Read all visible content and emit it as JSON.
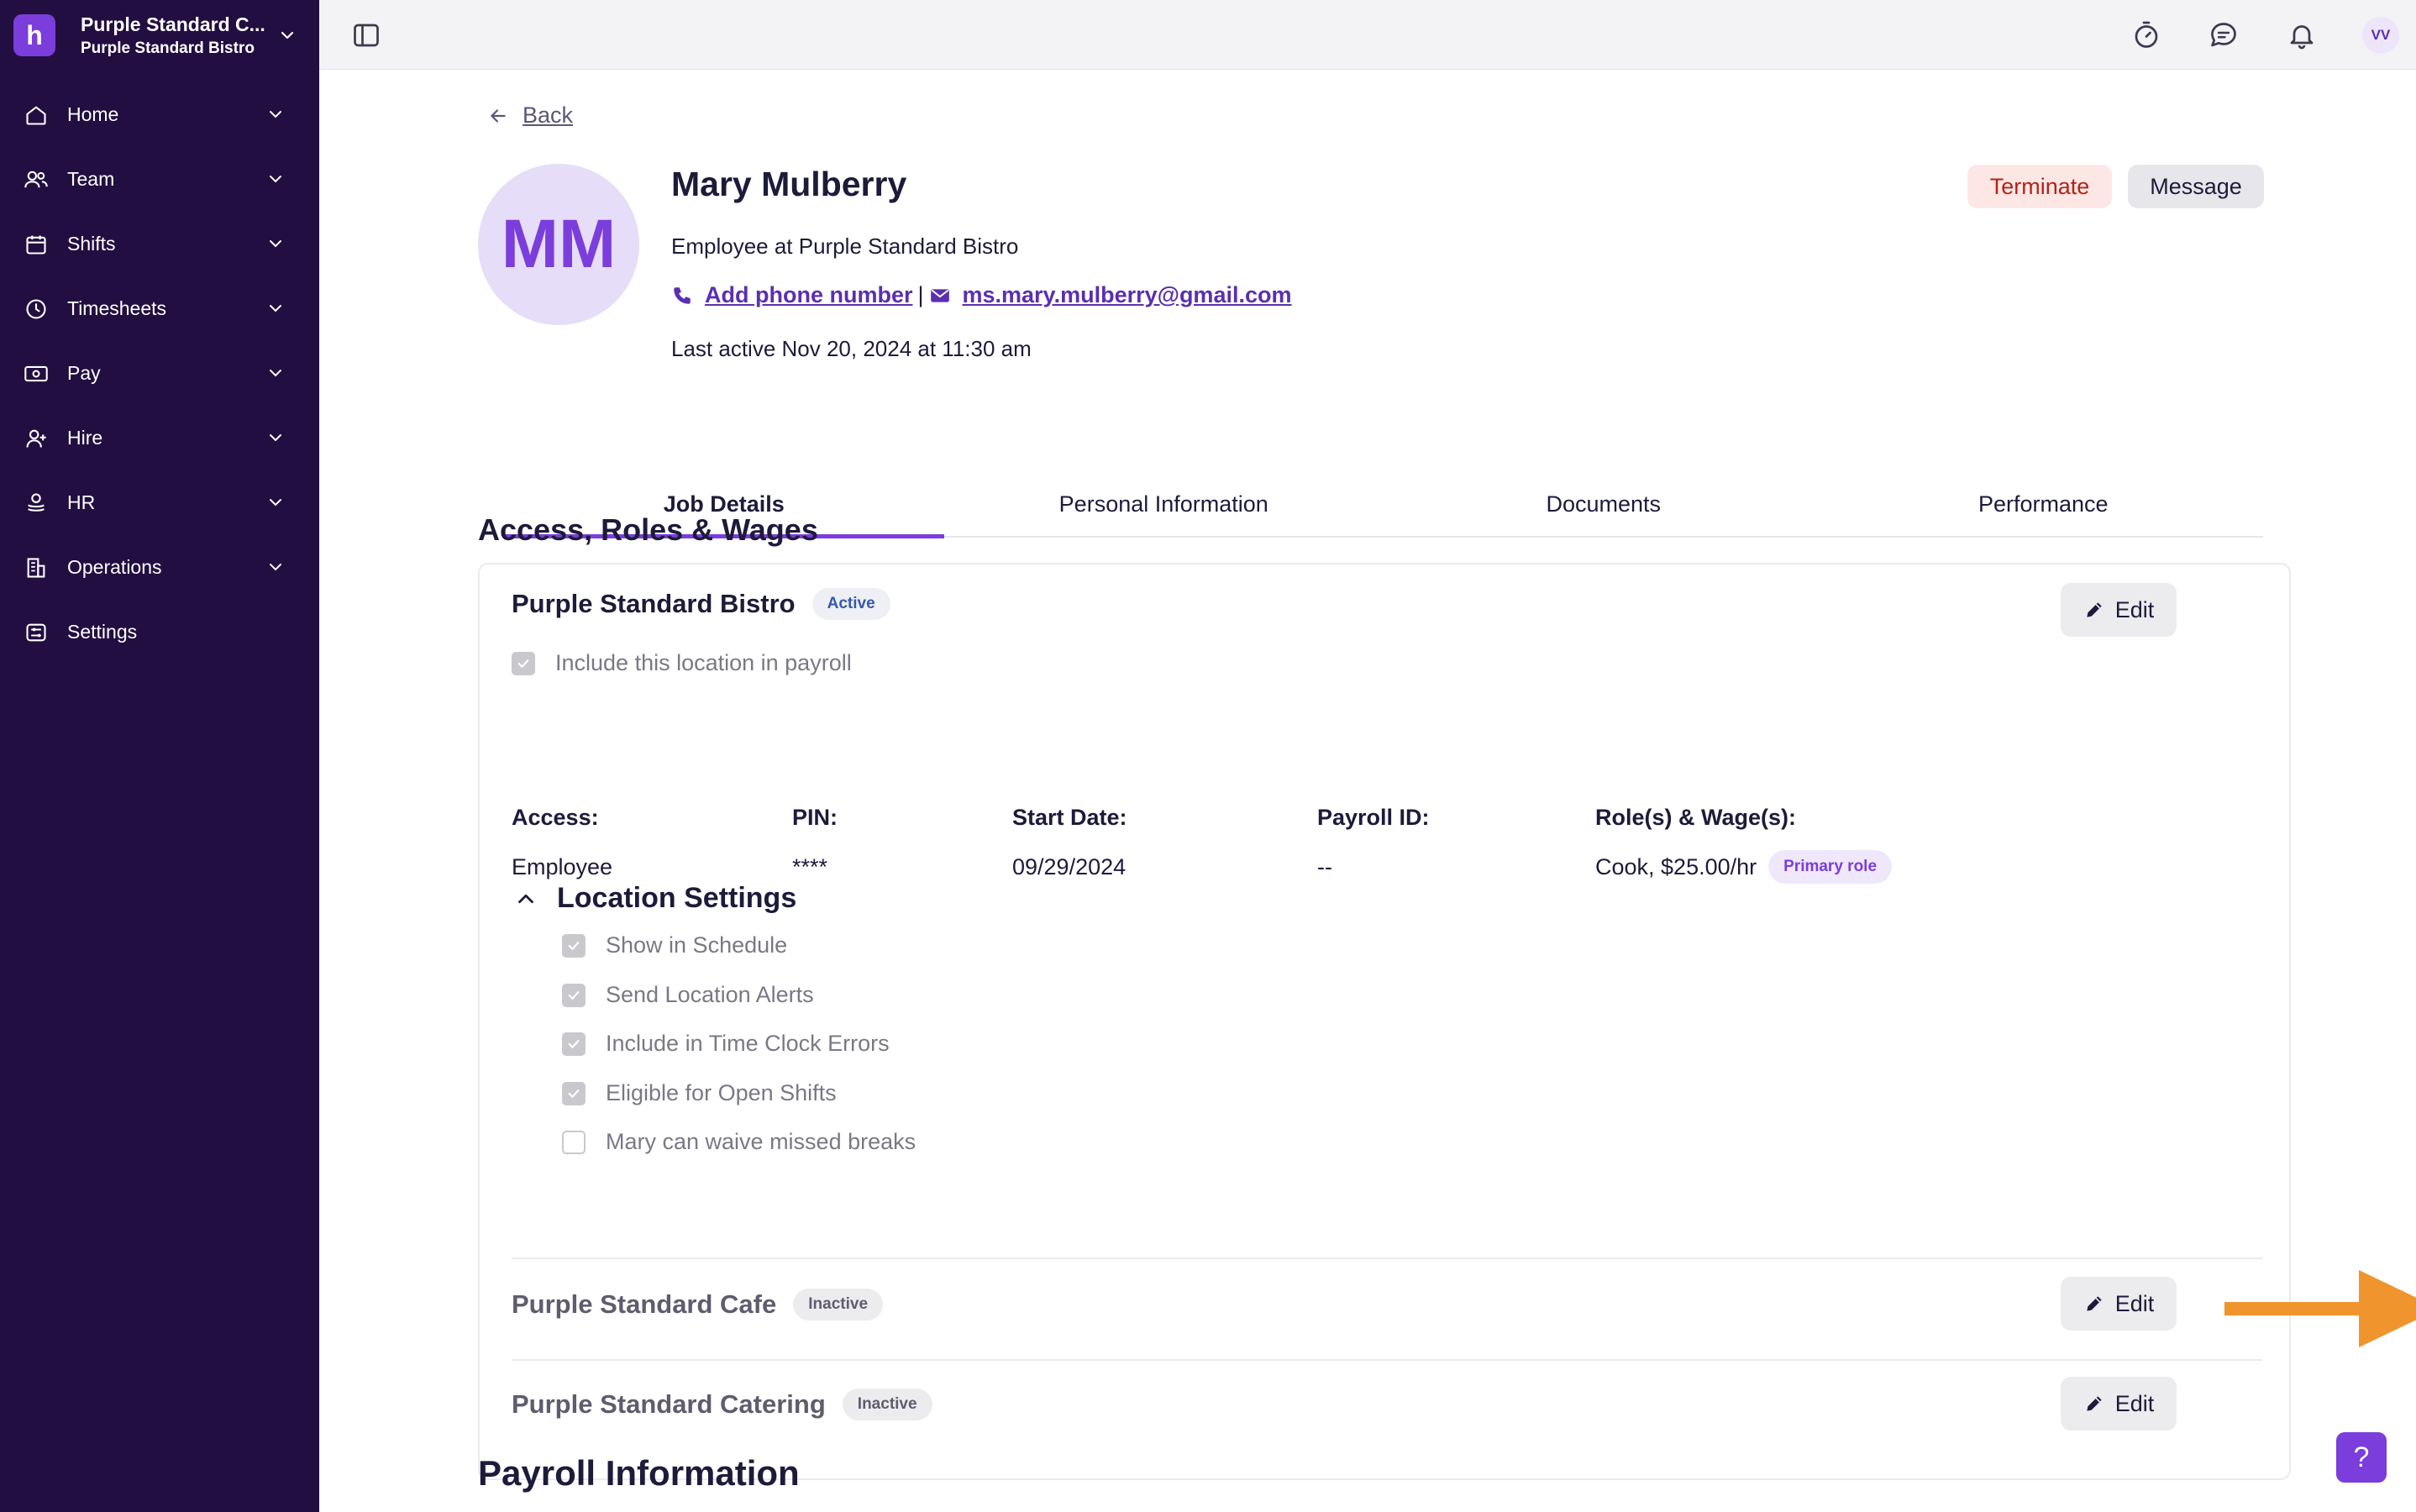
{
  "sidebar": {
    "org_name": "Purple Standard C...",
    "org_sub": "Purple Standard Bistro",
    "logo_letter": "h",
    "items": [
      {
        "label": "Home",
        "icon": "home-icon"
      },
      {
        "label": "Team",
        "icon": "team-icon"
      },
      {
        "label": "Shifts",
        "icon": "calendar-icon"
      },
      {
        "label": "Timesheets",
        "icon": "clock-icon"
      },
      {
        "label": "Pay",
        "icon": "money-icon"
      },
      {
        "label": "Hire",
        "icon": "hire-icon"
      },
      {
        "label": "HR",
        "icon": "hr-icon"
      },
      {
        "label": "Operations",
        "icon": "building-icon"
      },
      {
        "label": "Settings",
        "icon": "settings-icon"
      }
    ]
  },
  "topbar": {
    "avatar_initials": "VV",
    "icons": [
      "stopwatch-icon",
      "chat-icon",
      "bell-icon"
    ]
  },
  "header": {
    "back_label": "Back",
    "avatar_initials": "MM",
    "name": "Mary Mulberry",
    "subtitle": "Employee at Purple Standard Bistro",
    "phone_link": "Add phone number",
    "separator": "|",
    "email": "ms.mary.mulberry@gmail.com",
    "last_active": "Last active Nov 20, 2024 at 11:30 am",
    "terminate_label": "Terminate",
    "message_label": "Message"
  },
  "tabs": [
    "Job Details",
    "Personal Information",
    "Documents",
    "Performance"
  ],
  "active_tab": "Job Details",
  "access_section": {
    "title": "Access, Roles & Wages",
    "primary_location": {
      "name": "Purple Standard Bistro",
      "status": "Active",
      "payroll_checkbox": "Include this location in payroll",
      "edit_label": "Edit",
      "fields": {
        "access_label": "Access:",
        "access_value": "Employee",
        "pin_label": "PIN:",
        "pin_value": "****",
        "start_label": "Start Date:",
        "start_value": "09/29/2024",
        "payroll_label": "Payroll ID:",
        "payroll_value": "--",
        "roles_label": "Role(s) & Wage(s):",
        "roles_value": "Cook, $25.00/hr",
        "roles_badge": "Primary role"
      },
      "location_settings": {
        "title": "Location Settings",
        "options": [
          {
            "label": "Show in Schedule",
            "checked": true
          },
          {
            "label": "Send Location Alerts",
            "checked": true
          },
          {
            "label": "Include in Time Clock Errors",
            "checked": true
          },
          {
            "label": "Eligible for Open Shifts",
            "checked": true
          },
          {
            "label": "Mary can waive missed breaks",
            "checked": false
          }
        ]
      }
    },
    "other_locations": [
      {
        "name": "Purple Standard Cafe",
        "status": "Inactive",
        "edit_label": "Edit"
      },
      {
        "name": "Purple Standard Catering",
        "status": "Inactive",
        "edit_label": "Edit"
      }
    ]
  },
  "payroll_section": {
    "title": "Payroll Information"
  },
  "colors": {
    "sidebar_bg": "#220e40",
    "accent": "#7b3ddb",
    "annotation_arrow": "#f0952e"
  },
  "help_label": "?"
}
